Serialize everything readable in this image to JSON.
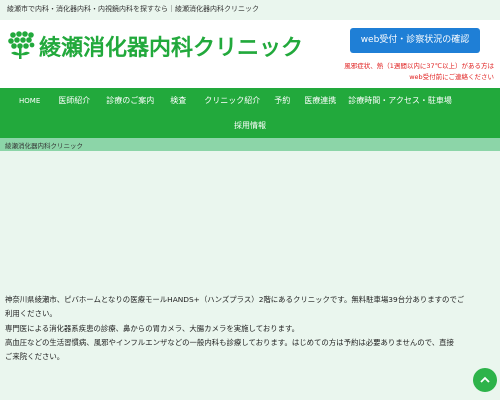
{
  "topbar": {
    "text": "綾瀬市で内科・消化器内科・内視鏡内科を探すなら｜綾瀬消化器内科クリニック"
  },
  "header": {
    "logo_text": "綾瀬消化器内科クリニック",
    "cta_label": "web受付・診察状況の確認",
    "notice_line1": "風邪症状、熱（1週間以内に37℃以上）がある方は",
    "notice_line2": "web受付前にご連絡ください"
  },
  "nav": {
    "row1": [
      "HOME",
      "医師紹介",
      "診療のご案内",
      "検査",
      "クリニック紹介",
      "予約",
      "医療連携",
      "診療時間・アクセス・駐車場"
    ],
    "row2": [
      "採用情報"
    ]
  },
  "breadcrumb": "綾瀬消化器内科クリニック",
  "intro": {
    "line1": "神奈川県綾瀬市、ピバホームとなりの医療モールHANDS+（ハンズプラス）2階にあるクリニックです。無料駐車場39台分ありますのでご",
    "line2": "利用ください。",
    "line3": "専門医による消化器系疾患の診療、鼻からの胃カメラ、大腸カメラを実施しております。",
    "line4": "高血圧などの生活習慣病、風邪やインフルエンザなどの一般内科も診療しております。はじめての方は予約は必要ありませんので、直接",
    "line5": "ご来院ください。"
  },
  "colors": {
    "brand_green": "#22a93c",
    "cta_blue": "#1f7fd6",
    "notice_red": "#e02020",
    "breadcrumb_bg": "#8cd5a8",
    "page_bg": "#eaf6ee"
  },
  "icons": {
    "logo": "clover-cluster-icon",
    "scroll_top": "chevron-up-icon"
  }
}
